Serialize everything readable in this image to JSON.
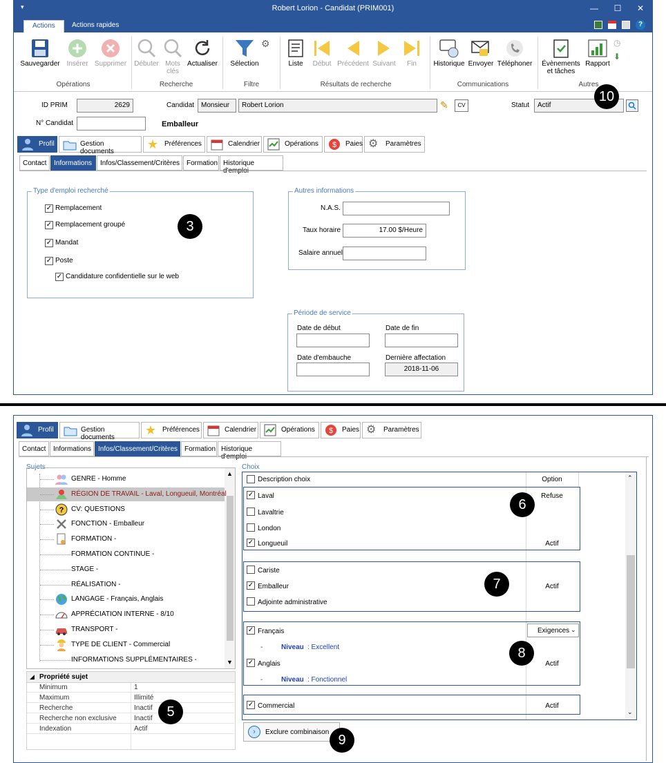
{
  "window": {
    "title": "Robert Lorion - Candidat (PRIM001)",
    "ribbon_tabs": [
      "Actions",
      "Actions rapides"
    ]
  },
  "ribbon": {
    "groups": {
      "operations": "Opérations",
      "recherche": "Recherche",
      "filtre": "Filtre",
      "resultats": "Résultats de recherche",
      "communications": "Communications",
      "autres": "Autres"
    },
    "buttons": {
      "sauvegarder": "Sauvegarder",
      "inserer": "Insérer",
      "supprimer": "Supprimer",
      "debuter": "Débuter",
      "mots_cles": "Mots clés",
      "actualiser": "Actualiser",
      "selection": "Sélection",
      "liste": "Liste",
      "debut": "Début",
      "precedent": "Précédent",
      "suivant": "Suivant",
      "fin": "Fin",
      "historique": "Historique",
      "envoyer": "Envoyer",
      "telephoner": "Téléphoner",
      "evenements": "Évènements et tâches",
      "rapport": "Rapport"
    }
  },
  "header": {
    "id_prim_label": "ID PRIM",
    "id_prim_value": "2629",
    "candidat_label": "Candidat",
    "civilite": "Monsieur",
    "nom": "Robert Lorion",
    "statut_label": "Statut",
    "statut_value": "Actif",
    "no_candidat_label": "N° Candidat",
    "no_candidat_value": "",
    "fonction": "Emballeur"
  },
  "main_tabs": [
    "Profil",
    "Gestion documents",
    "Préférences",
    "Calendrier",
    "Opérations",
    "Paies",
    "Paramètres"
  ],
  "sub_tabs": [
    "Contact",
    "Informations",
    "Infos/Classement/Critères",
    "Formation",
    "Historique d'emploi"
  ],
  "type_emploi": {
    "title": "Type d'emploi recherché",
    "items": [
      {
        "label": "Remplacement",
        "checked": true
      },
      {
        "label": "Remplacement groupé",
        "checked": true
      },
      {
        "label": "Mandat",
        "checked": true
      },
      {
        "label": "Poste",
        "checked": true
      },
      {
        "label": "Candidature confidentielle sur le web",
        "checked": true
      }
    ]
  },
  "autres_info": {
    "title": "Autres informations",
    "nas_label": "N.A.S.",
    "nas_value": "",
    "taux_label": "Taux horaire",
    "taux_value": "17.00 $/Heure",
    "salaire_label": "Salaire annuel",
    "salaire_value": ""
  },
  "periode": {
    "title": "Période de service",
    "debut_label": "Date de début",
    "fin_label": "Date de fin",
    "embauche_label": "Date d'embauche",
    "derniere_label": "Dernière affectation",
    "derniere_value": "2018-11-06"
  },
  "badges": {
    "b3": "3",
    "b10": "10",
    "b5": "5",
    "b6": "6",
    "b7": "7",
    "b8": "8",
    "b9": "9"
  },
  "sujets": {
    "title": "Sujets",
    "items": [
      {
        "label": "GENRE - Homme",
        "icon": "people-icon"
      },
      {
        "label": "RÉGION DE TRAVAIL - Laval, Longueuil, Montréal",
        "icon": "map-pin-icon",
        "selected": true
      },
      {
        "label": "CV: QUESTIONS",
        "icon": "question-icon"
      },
      {
        "label": "FONCTION - Emballeur",
        "icon": "tools-icon"
      },
      {
        "label": "FORMATION -",
        "icon": "certificate-icon"
      },
      {
        "label": "FORMATION CONTINUE -",
        "icon": ""
      },
      {
        "label": "STAGE -",
        "icon": ""
      },
      {
        "label": "RÉALISATION -",
        "icon": ""
      },
      {
        "label": "LANGAGE - Français, Anglais",
        "icon": "globe-icon"
      },
      {
        "label": "APPRÉCIATION INTERNE - 8/10",
        "icon": "gauge-icon"
      },
      {
        "label": "TRANSPORT -",
        "icon": "car-icon"
      },
      {
        "label": "TYPE DE CLIENT - Commercial",
        "icon": "worker-icon"
      },
      {
        "label": "INFORMATIONS SUPPLÉMENTAIRES -",
        "icon": ""
      }
    ]
  },
  "propriete": {
    "title": "Propriété sujet",
    "rows": [
      {
        "k": "Minimum",
        "v": "1"
      },
      {
        "k": "Maximum",
        "v": "Illimité"
      },
      {
        "k": "Recherche",
        "v": "Inactif"
      },
      {
        "k": "Recherche non exclusive",
        "v": "Inactif"
      },
      {
        "k": "Indexation",
        "v": "Actif"
      }
    ]
  },
  "choix": {
    "title": "Choix",
    "header_label": "Description choix",
    "header_option": "Option",
    "regions": [
      {
        "label": "Laval",
        "checked": true,
        "option": "Refuse"
      },
      {
        "label": "Lavaltrie",
        "checked": false,
        "option": ""
      },
      {
        "label": "London",
        "checked": false,
        "option": ""
      },
      {
        "label": "Longueuil",
        "checked": true,
        "option": "Actif"
      }
    ],
    "fonctions": [
      {
        "label": "Cariste",
        "checked": false,
        "option": ""
      },
      {
        "label": "Emballeur",
        "checked": true,
        "option": "Actif"
      },
      {
        "label": "Adjointe administrative",
        "checked": false,
        "option": ""
      }
    ],
    "langues": {
      "francais": "Français",
      "francais_option": "Exigences",
      "niveau_label": "Niveau",
      "niveau_fr": ": Excellent",
      "anglais": "Anglais",
      "anglais_option": "Actif",
      "niveau_en": ": Fonctionnel",
      "dash": "-"
    },
    "client": {
      "label": "Commercial",
      "option": "Actif"
    },
    "exclure": "Exclure combinaison"
  }
}
